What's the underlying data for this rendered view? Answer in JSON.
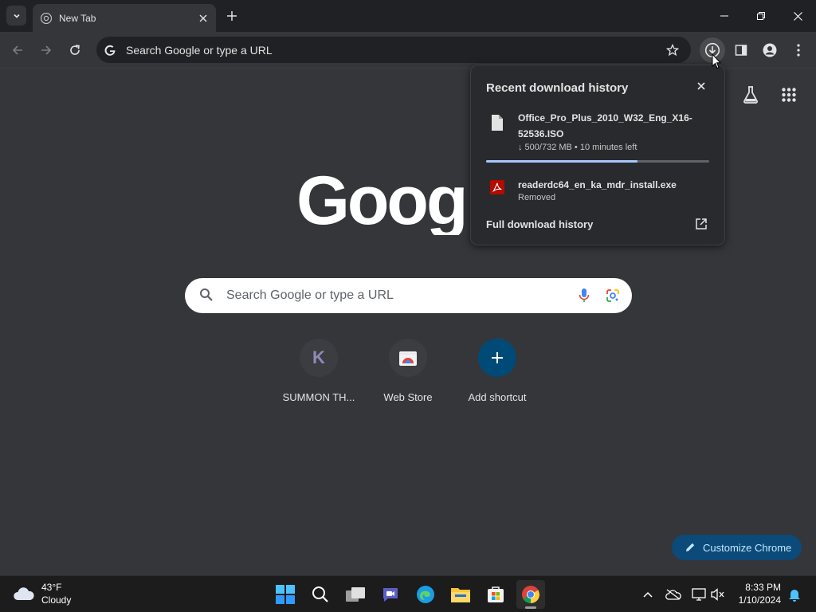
{
  "tab": {
    "title": "New Tab"
  },
  "omnibox": {
    "placeholder": "Search Google or type a URL"
  },
  "ntp": {
    "logo_text": "Google",
    "search_placeholder": "Search Google or type a URL",
    "shortcuts": [
      {
        "label": "SUMMON TH...",
        "icon": "K"
      },
      {
        "label": "Web Store",
        "icon": "web-store-icon"
      },
      {
        "label": "Add shortcut",
        "icon": "plus-icon"
      }
    ],
    "customize_label": "Customize Chrome"
  },
  "downloads": {
    "title": "Recent download history",
    "items": [
      {
        "name": "Office_Pro_Plus_2010_W32_Eng_X16-52536.ISO",
        "status": "↓ 500/732 MB • 10 minutes left",
        "progress": 0.68,
        "icon": "file-icon"
      },
      {
        "name": "readerdc64_en_ka_mdr_install.exe",
        "status": "Removed",
        "icon": "pdf-icon"
      }
    ],
    "full_history": "Full download history"
  },
  "taskbar": {
    "weather_temp": "43°F",
    "weather_desc": "Cloudy",
    "time": "8:33 PM",
    "date": "1/10/2024"
  },
  "colors": {
    "accent": "#a8c7fa",
    "customize_bg": "#0b4a79",
    "add_shortcut_bg": "#004a77"
  }
}
